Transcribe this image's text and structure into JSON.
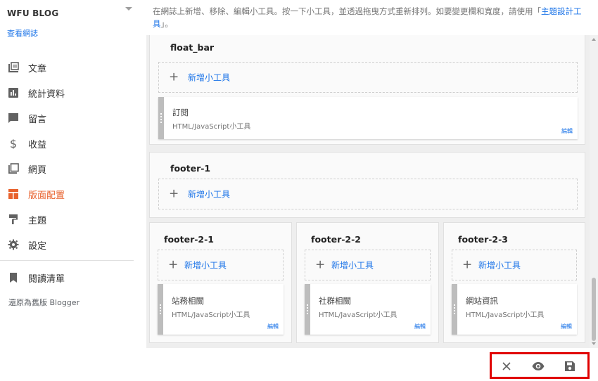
{
  "sidebar": {
    "blog_name": "WFU BLOG",
    "view_blog": "查看網誌",
    "items": [
      {
        "label": "文章",
        "icon": "posts-icon"
      },
      {
        "label": "統計資料",
        "icon": "stats-icon"
      },
      {
        "label": "留言",
        "icon": "comments-icon"
      },
      {
        "label": "收益",
        "icon": "dollar-icon"
      },
      {
        "label": "網頁",
        "icon": "pages-icon"
      },
      {
        "label": "版面配置",
        "icon": "layout-icon",
        "active": true
      },
      {
        "label": "主題",
        "icon": "theme-roller-icon"
      },
      {
        "label": "設定",
        "icon": "gear-icon"
      }
    ],
    "reading_list": "閱讀清單",
    "legacy": "還原為舊版 Blogger"
  },
  "intro": {
    "text": "在網誌上新增、移除、編輯小工具。按一下小工具，並透過拖曳方式重新排列。如要變更欄和寬度，請使用「",
    "link": "主題設計工具",
    "suffix": "」。"
  },
  "sections": {
    "float_bar": {
      "title": "float_bar"
    },
    "footer1": {
      "title": "footer-1"
    },
    "footer21": {
      "title": "footer-2-1"
    },
    "footer22": {
      "title": "footer-2-2"
    },
    "footer23": {
      "title": "footer-2-3"
    }
  },
  "add_gadget_label": "新增小工具",
  "gadgets": {
    "subscribe": {
      "name": "訂閱",
      "type": "HTML/JavaScript小工具",
      "edit": "編輯"
    },
    "site_related": {
      "name": "站務相關",
      "type": "HTML/JavaScript小工具",
      "edit": "編輯"
    },
    "social": {
      "name": "社群相關",
      "type": "HTML/JavaScript小工具",
      "edit": "編輯"
    },
    "site_info": {
      "name": "網站資訊",
      "type": "HTML/JavaScript小工具",
      "edit": "編輯"
    }
  },
  "actions": {
    "close": "close-icon",
    "preview": "eye-icon",
    "save": "save-icon"
  },
  "colors": {
    "accent": "#e8612c",
    "link": "#1a73e8",
    "highlight_border": "#e00000"
  }
}
